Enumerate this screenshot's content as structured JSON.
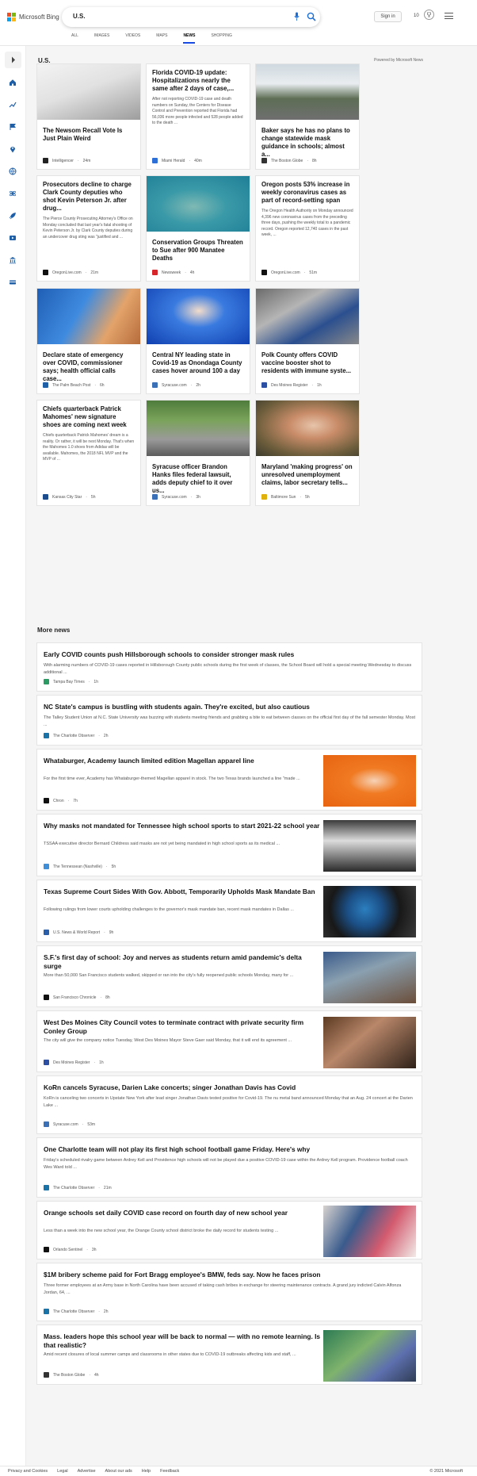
{
  "header": {
    "logo_text": "Microsoft Bing",
    "search_query": "U.S.",
    "sign_in": "Sign in",
    "rewards_count": "10"
  },
  "nav_tabs": [
    "ALL",
    "IMAGES",
    "VIDEOS",
    "MAPS",
    "NEWS",
    "SHOPPING"
  ],
  "active_tab": "NEWS",
  "section": {
    "title": "U.S.",
    "powered_by": "Powered by Microsoft News"
  },
  "cards": [
    {
      "title": "The Newsom Recall Vote Is Just Plain Weird",
      "text": "",
      "source": "Intelligencer",
      "age": "24m",
      "image": "ballot",
      "logo_color": "#222"
    },
    {
      "title": "Florida COVID-19 update: Hospitalizations nearly the same after 2 days of case,...",
      "text": "After not reporting COVID-19 case and death numbers on Sunday, the Centers for Disease Control and Prevention reported that Florida had 56,036 more people infected and 528 people added to the death ...",
      "source": "Miami Herald",
      "age": "40m",
      "image": "",
      "logo_color": "#2d6fd6"
    },
    {
      "title": "Baker says he has no plans to change statewide mask guidance in schools; almost a...",
      "text": "",
      "source": "The Boston Globe",
      "age": "8h",
      "image": "cars",
      "logo_color": "#333"
    },
    {
      "title": "Prosecutors decline to charge Clark County deputies who shot Kevin Peterson Jr. after drug...",
      "text": "The Pierce County Prosecuting Attorney's Office on Monday concluded that last year's fatal shooting of Kevin Peterson Jr. by Clark County deputies during an undercover drug sting was \"justified and ...",
      "source": "OregonLive.com",
      "age": "21m",
      "image": "",
      "logo_color": "#111"
    },
    {
      "title": "Conservation Groups Threaten to Sue after 900 Manatee Deaths",
      "text": "",
      "source": "Newsweek",
      "age": "4h",
      "image": "manatee",
      "logo_color": "#d6262b"
    },
    {
      "title": "Oregon posts 53% increase in weekly coronavirus cases as part of record-setting span",
      "text": "The Oregon Health Authority on Monday announced 4,396 new coronavirus cases from the preceding three days, pushing the weekly total to a pandemic record. Oregon reported 12,740 cases in the past week, ...",
      "source": "OregonLive.com",
      "age": "51m",
      "image": "",
      "logo_color": "#111"
    },
    {
      "title": "Declare state of emergency over COVID, commissioner says; health official calls case...",
      "text": "",
      "source": "The Palm Beach Post",
      "age": "6h",
      "image": "vaccine",
      "logo_color": "#1f5fa8"
    },
    {
      "title": "Central NY leading state in Covid-19 as Onondaga County cases hover around 100 a day",
      "text": "",
      "source": "Syracuse.com",
      "age": "2h",
      "image": "podium",
      "logo_color": "#3b6fb6"
    },
    {
      "title": "Polk County offers COVID vaccine booster shot to residents with immune syste...",
      "text": "",
      "source": "Des Moines Register",
      "age": "1h",
      "image": "carshot",
      "logo_color": "#2c4fa3"
    },
    {
      "title": "Chiefs quarterback Patrick Mahomes' new signature shoes are coming next week",
      "text": "Chiefs quarterback Patrick Mahomes' dream is a reality. Or rather, it will be next Monday. That's when the Mahomes 1.0 shoes from Adidas will be available. Mahomes, the 2018 NFL MVP and the MVP of ...",
      "source": "Kansas City Star",
      "age": "5h",
      "image": "",
      "logo_color": "#1d4c8c"
    },
    {
      "title": "Syracuse officer Brandon Hanks files federal lawsuit, adds deputy chief to it over us...",
      "text": "",
      "source": "Syracuse.com",
      "age": "3h",
      "image": "court",
      "logo_color": "#3b6fb6"
    },
    {
      "title": "Maryland 'making progress' on unresolved unemployment claims, labor secretary tells...",
      "text": "",
      "source": "Baltimore Sun",
      "age": "5h",
      "image": "woman",
      "logo_color": "#e0b10d"
    }
  ],
  "more_news": {
    "heading": "More news",
    "items": [
      {
        "title": "Early COVID counts push Hillsborough schools to consider stronger mask rules",
        "text": "With alarming numbers of COVID-19 cases reported in Hillsborough County public schools during the first week of classes, the School Board will hold a special meeting Wednesday to discuss additional ...",
        "source": "Tampa Bay Times",
        "age": "1h",
        "image": "",
        "logo_color": "#2b9a63"
      },
      {
        "title": "NC State's campus is bustling with students again. They're excited, but also cautious",
        "text": "The Talley Student Union at N.C. State University was buzzing with students meeting friends and grabbing a bite to eat between classes on the official first day of the fall semester Monday. Most ...",
        "source": "The Charlotte Observer",
        "age": "2h",
        "image": "",
        "logo_color": "#1a73a8"
      },
      {
        "title": "Whataburger, Academy launch limited edition Magellan apparel line",
        "text": "For the first time ever, Academy has Whataburger-themed Magellan apparel in stock. The two Texas brands launched a line \"made ...",
        "source": "Chron",
        "age": "7h",
        "image": "orange",
        "logo_color": "#111"
      },
      {
        "title": "Why masks not mandated for Tennessee high school sports to start 2021-22 school year",
        "text": "TSSAA executive director Bernard Childress said masks are not yet being mandated in high school sports as its medical ...",
        "source": "The Tennessean (Nashville)",
        "age": "5h",
        "image": "crowd",
        "logo_color": "#3f8fd8"
      },
      {
        "title": "Texas Supreme Court Sides With Gov. Abbott, Temporarily Upholds Mask Mandate Ban",
        "text": "Following rulings from lower courts upholding challenges to the governor's mask mandate ban, recent mask mandates in Dallas ...",
        "source": "U.S. News & World Report",
        "age": "9h",
        "image": "seal",
        "logo_color": "#2a5ea8"
      },
      {
        "title": "S.F.'s first day of school: Joy and nerves as students return amid pandemic's delta surge",
        "text": "More than 50,000 San Francisco students walked, skipped or ran into the city's fully reopened public schools Monday, many for ...",
        "source": "San Francisco Chronicle",
        "age": "8h",
        "image": "classroom",
        "logo_color": "#111"
      },
      {
        "title": "West Des Moines City Council votes to terminate contract with private security firm Conley Group",
        "text": "The city will give the company notice Tuesday, West Des Moines Mayor Steve Gaer said Monday, that it will end its agreement ...",
        "source": "Des Moines Register",
        "age": "1h",
        "image": "meeting",
        "logo_color": "#2c4fa3"
      },
      {
        "title": "KoRn cancels Syracuse, Darien Lake concerts; singer Jonathan Davis has Covid",
        "text": "KoRn is canceling two concerts in Upstate New York after lead singer Jonathan Davis tested positive for Covid-19. The nu metal band announced Monday that an Aug. 24 concert at the Darien Lake ...",
        "source": "Syracuse.com",
        "age": "53m",
        "image": "",
        "logo_color": "#3b6fb6"
      },
      {
        "title": "One Charlotte team will not play its first high school football game Friday. Here's why",
        "text": "Friday's scheduled rivalry game between Ardrey Kell and Providence high schools will not be played due a positive COVID-19 case within the Ardrey Kell program. Providence football coach Wes Ward told ...",
        "source": "The Charlotte Observer",
        "age": "21m",
        "image": "",
        "logo_color": "#1a73a8"
      },
      {
        "title": "Orange schools set daily COVID case record on fourth day of new school year",
        "text": "Less than a week into the new school year, the Orange County school district broke the daily record for students testing ...",
        "source": "Orlando Sentinel",
        "age": "3h",
        "image": "kids",
        "logo_color": "#111"
      },
      {
        "title": "$1M bribery scheme paid for Fort Bragg employee's BMW, feds say. Now he faces prison",
        "text": "Three former employees at an Army base in North Carolina have been accused of taking cash bribes in exchange for steering maintenance contracts. A grand jury indicted Calvin Alfonza Jordan, 64, ...",
        "source": "The Charlotte Observer",
        "age": "2h",
        "image": "",
        "logo_color": "#1a73a8"
      },
      {
        "title": "Mass. leaders hope this school year will be back to normal — with no remote learning. Is that realistic?",
        "text": "Amid recent closures of local summer camps and classrooms in other states due to COVID-19 outbreaks affecting kids and staff, ...",
        "source": "The Boston Globe",
        "age": "4h",
        "image": "students",
        "logo_color": "#333"
      }
    ]
  },
  "footer": {
    "links": [
      "Privacy and Cookies",
      "Legal",
      "Advertise",
      "About our ads",
      "Help",
      "Feedback"
    ],
    "copyright": "© 2021 Microsoft"
  }
}
